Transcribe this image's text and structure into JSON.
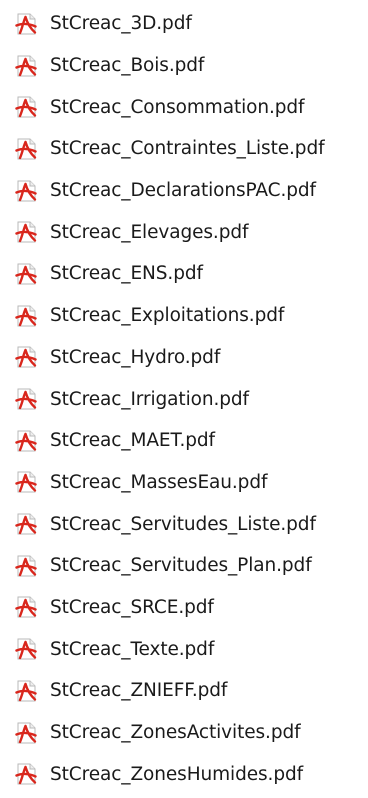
{
  "file_list": {
    "icon": "pdf-file-icon",
    "icon_color": "#d9261c",
    "items": [
      {
        "name": "StCreac_3D.pdf"
      },
      {
        "name": "StCreac_Bois.pdf"
      },
      {
        "name": "StCreac_Consommation.pdf"
      },
      {
        "name": "StCreac_Contraintes_Liste.pdf"
      },
      {
        "name": "StCreac_DeclarationsPAC.pdf"
      },
      {
        "name": "StCreac_Elevages.pdf"
      },
      {
        "name": "StCreac_ENS.pdf"
      },
      {
        "name": "StCreac_Exploitations.pdf"
      },
      {
        "name": "StCreac_Hydro.pdf"
      },
      {
        "name": "StCreac_Irrigation.pdf"
      },
      {
        "name": "StCreac_MAET.pdf"
      },
      {
        "name": "StCreac_MassesEau.pdf"
      },
      {
        "name": "StCreac_Servitudes_Liste.pdf"
      },
      {
        "name": "StCreac_Servitudes_Plan.pdf"
      },
      {
        "name": "StCreac_SRCE.pdf"
      },
      {
        "name": "StCreac_Texte.pdf"
      },
      {
        "name": "StCreac_ZNIEFF.pdf"
      },
      {
        "name": "StCreac_ZonesActivites.pdf"
      },
      {
        "name": "StCreac_ZonesHumides.pdf"
      }
    ]
  }
}
